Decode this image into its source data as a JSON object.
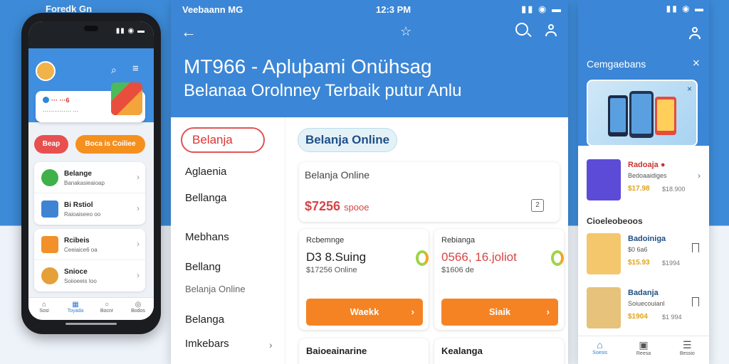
{
  "page": {
    "top_left_label": "Foredk Gn"
  },
  "phone": {
    "status": {
      "icons": "▮▮ ◉ ▬"
    },
    "search_icon": "⌕",
    "menu_icon": "≡",
    "banner": {
      "title": "··· ···6",
      "subtitle": "··············· ···"
    },
    "pills": [
      "Beap",
      "Boca is Coiliee"
    ],
    "items": [
      {
        "name": "Belange",
        "sub": "Banakasieaioap",
        "color": "#3fb04a"
      },
      {
        "name": "Bi Rstiol",
        "sub": "Raioaiseeo oo",
        "color": "#3f84d3"
      },
      {
        "name": "Rcibeis",
        "sub": "Ceeiaice6 oa",
        "color": "#f2902a"
      },
      {
        "name": "Snioce",
        "sub": "Soiioeeis Ioo",
        "color": "#e5a03a"
      }
    ],
    "nav": [
      {
        "icon": "⌂",
        "label": "Sosi"
      },
      {
        "icon": "▦",
        "label": "Toyada"
      },
      {
        "icon": "○",
        "label": "Bocnr"
      },
      {
        "icon": "◎",
        "label": "Bodos"
      }
    ]
  },
  "center": {
    "status_left": "Veebaann MG",
    "status_time": "12:3 PM",
    "status_icons": "▮▮ ◉ ▬",
    "back_icon": "←",
    "star_icon": "☆",
    "title_line1": "MT966 - Apluþami Onühsag",
    "title_line2": "Belanaa Orolnney Terbaik putur Anlu",
    "left_chip": "Belanja",
    "left_nav": [
      {
        "label": "Aglaenia",
        "small": false
      },
      {
        "label": "Bellanga",
        "small": false
      },
      {
        "label": "Mebhans",
        "small": false
      },
      {
        "label": "Bellang",
        "small": false
      },
      {
        "label": "Belanja Online",
        "small": true
      },
      {
        "label": "Belanga",
        "small": false
      },
      {
        "label": "Imkebars",
        "small": false
      }
    ],
    "chevron": "›",
    "active_chip": "Belanja Online",
    "main_card": {
      "label": "Belanja Online",
      "price": "$7256",
      "price_suffix": "spooe",
      "checkbox_icon": "2"
    },
    "products": [
      {
        "kicker": "Rcbemnge",
        "title": "D3 8.Suing",
        "sub": "$17256 Online",
        "button": "Waekk",
        "title_red": false
      },
      {
        "kicker": "Rebianga",
        "title": "0566, 16.joliot",
        "sub": "$1606 de",
        "button": "Siaik",
        "title_red": true
      }
    ],
    "products_bottom": [
      "Baioeainarine",
      "Kealanga"
    ]
  },
  "right": {
    "status_icons": "▮▮ ◉ ▬",
    "title": "Cemgaebans",
    "close_icon": "⨯",
    "banner_close": "×",
    "items": [
      {
        "name": "Radoaja ●",
        "sub": "Bedoaaidiges",
        "price": "$17.98",
        "price2": "$18.900",
        "color": "#5c4bd6",
        "red": true
      },
      {
        "name": "Badoiniga",
        "sub": "$0 6a6",
        "price": "$15.93",
        "price2": "$1994",
        "color": "#f4c76c",
        "red": false
      },
      {
        "name": "Badanja",
        "sub": "Soiuecouianl",
        "price": "$1904",
        "price2": "$1 994",
        "color": "#e6c27a",
        "red": false
      }
    ],
    "section": "Cioeleobeoos",
    "nav": [
      {
        "icon": "⌂",
        "label": "Soesis"
      },
      {
        "icon": "▣",
        "label": "Reesa"
      },
      {
        "icon": "☰",
        "label": "Bessio"
      }
    ]
  },
  "colors": {
    "primary": "#3b86d6",
    "accent_orange": "#f58323",
    "accent_red": "#d64545"
  }
}
